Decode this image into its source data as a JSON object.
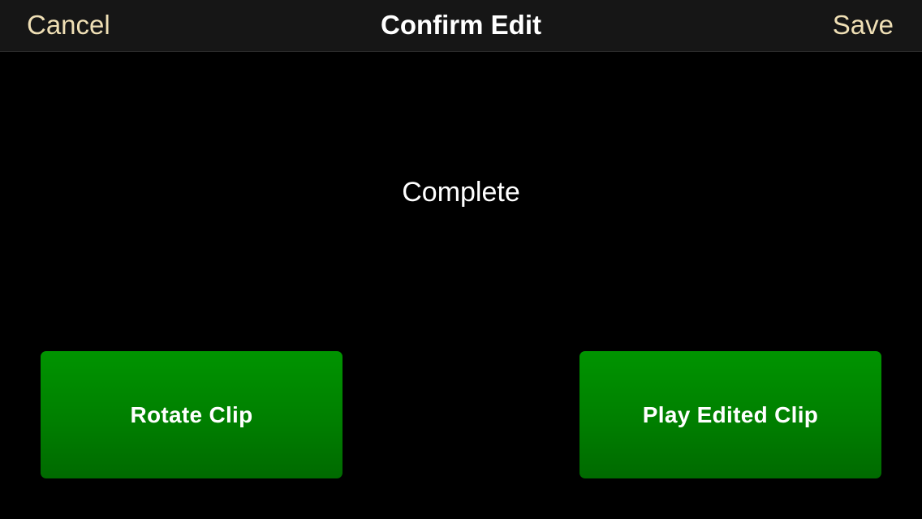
{
  "navbar": {
    "cancel_label": "Cancel",
    "title": "Confirm Edit",
    "save_label": "Save"
  },
  "main": {
    "status_text": "Complete"
  },
  "actions": {
    "rotate_label": "Rotate Clip",
    "play_label": "Play Edited Clip"
  },
  "colors": {
    "background": "#000000",
    "navbar_background": "#161616",
    "nav_button_text": "#efdfb5",
    "title_text": "#ffffff",
    "button_green": "#008a00"
  }
}
